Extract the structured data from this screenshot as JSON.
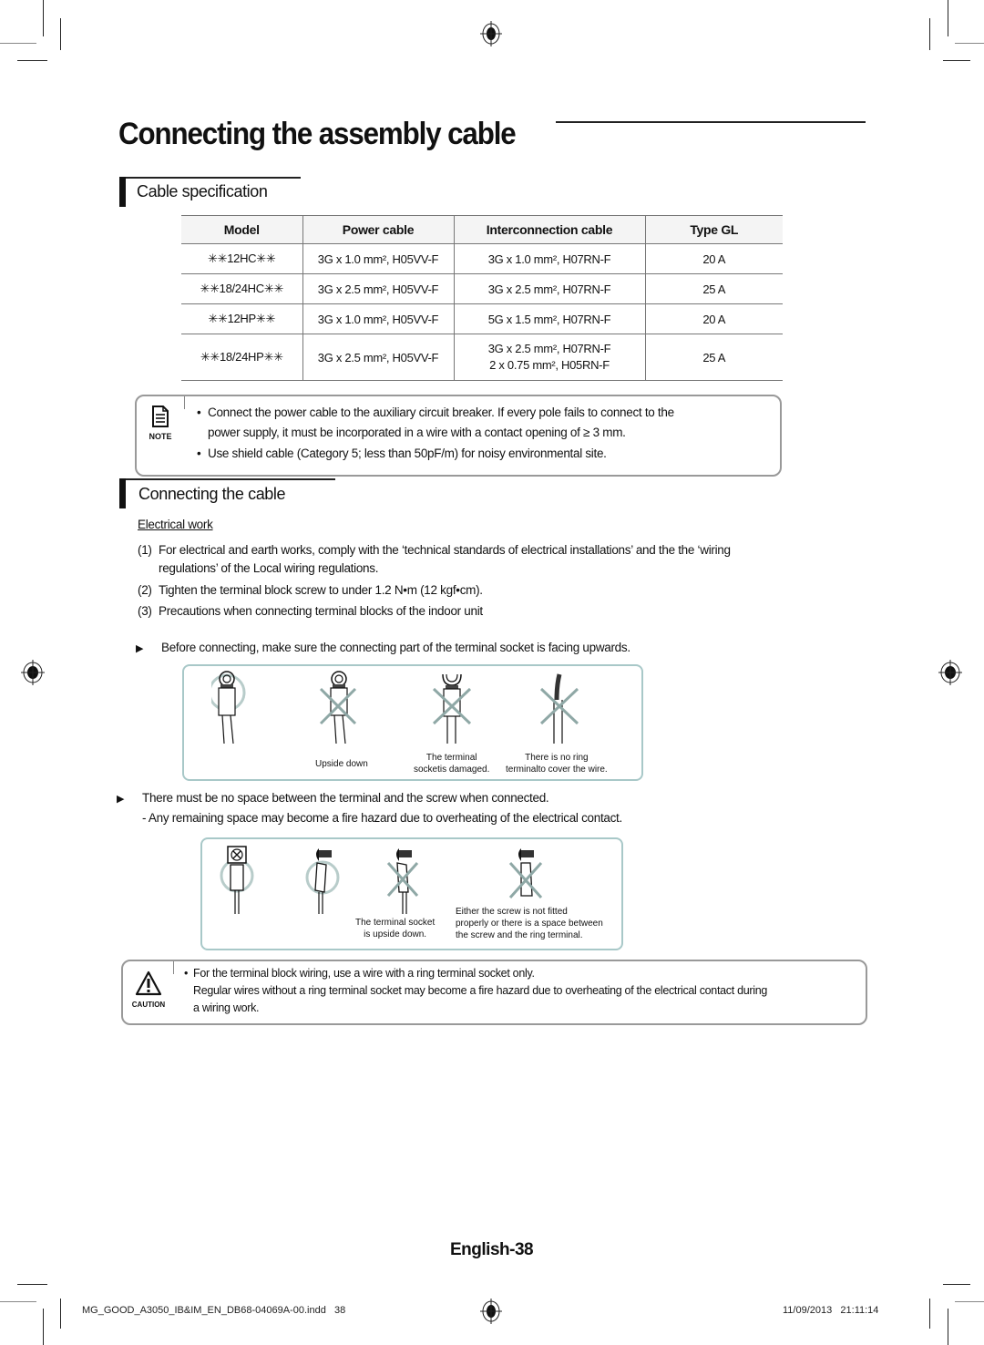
{
  "page_title": "Connecting the assembly cable",
  "cable_spec": {
    "heading": "Cable specification",
    "columns": [
      "Model",
      "Power cable",
      "Interconnection cable",
      "Type GL"
    ],
    "rows": [
      {
        "model": "✳✳12HC✳✳",
        "power": "3G x 1.0 mm², H05VV-F",
        "inter": [
          "3G x 1.0 mm², H07RN-F"
        ],
        "gl": "20 A"
      },
      {
        "model": "✳✳18/24HC✳✳",
        "power": "3G x 2.5 mm², H05VV-F",
        "inter": [
          "3G x 2.5 mm², H07RN-F"
        ],
        "gl": "25 A"
      },
      {
        "model": "✳✳12HP✳✳",
        "power": "3G x 1.0 mm², H05VV-F",
        "inter": [
          "5G x 1.5 mm², H07RN-F"
        ],
        "gl": "20 A"
      },
      {
        "model": "✳✳18/24HP✳✳",
        "power": "3G x 2.5 mm², H05VV-F",
        "inter": [
          "3G x 2.5 mm², H07RN-F",
          "2 x 0.75 mm², H05RN-F"
        ],
        "gl": "25 A"
      }
    ]
  },
  "note": {
    "label": "NOTE",
    "icon": "note-document-icon",
    "bullets": [
      [
        "Connect the power cable to the auxiliary circuit breaker. If every pole fails to connect to the",
        "power supply, it must be incorporated in a wire with a contact opening of ≥ 3 mm."
      ],
      [
        "Use shield cable (Category 5; less than 50pF/m) for noisy environmental site."
      ]
    ]
  },
  "connecting": {
    "heading": "Connecting the cable",
    "subheading": "Electrical work",
    "items": [
      {
        "num": "(1)",
        "lines": [
          "For electrical and earth works, comply with the ‘technical standards of electrical installations’ and the the ‘wiring",
          "regulations’ of the Local wiring regulations."
        ]
      },
      {
        "num": "(2)",
        "lines": [
          "Tighten the terminal block screw to under 1.2 N•m (12 kgf•cm)."
        ]
      },
      {
        "num": "(3)",
        "lines": [
          "Precautions when connecting terminal blocks of the indoor unit"
        ]
      }
    ],
    "tip1": "Before connecting, make sure the connecting part of the terminal socket is facing upwards.",
    "diagram1_captions": [
      "",
      "Upside down",
      "The terminal\nsocketis damaged.",
      "There is no ring\nterminalto cover the wire."
    ],
    "tip2": "There must be no space between the terminal and the screw when connected.",
    "tip2_sub": "- Any remaining space may become a fire hazard due to overheating of the electrical contact.",
    "diagram2_captions": [
      "",
      "",
      "The terminal socket\nis upside down.",
      "Either the screw is not fitted\nproperly or there is a space between\nthe screw and the ring terminal."
    ],
    "bullet_icon": "triangle-right-icon"
  },
  "caution": {
    "label": "CAUTION",
    "icon": "warning-triangle-icon",
    "lines": [
      "For the terminal block wiring, use a wire with a ring terminal socket only.",
      "Regular wires without a ring terminal socket may become a fire hazard due to overheating of the electrical contact during",
      "a wiring work."
    ]
  },
  "page_number": "English-38",
  "footer": {
    "file": "MG_GOOD_A3050_IB&IM_EN_DB68-04069A-00.indd   38",
    "datetime": "11/09/2013   21:11:14"
  },
  "colors": {
    "diagram_border": "#a8c8c8",
    "mark_gray": "#8fa8a6"
  }
}
